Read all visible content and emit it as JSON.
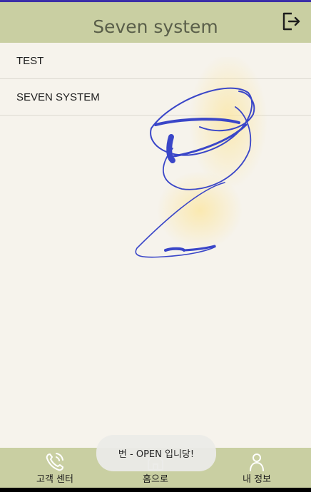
{
  "header": {
    "title": "Seven system",
    "logout_icon": "logout-icon"
  },
  "list": {
    "items": [
      {
        "label": "TEST"
      },
      {
        "label": "SEVEN SYSTEM"
      }
    ]
  },
  "bottom_nav": {
    "items": [
      {
        "label": "고객 센터",
        "icon": "phone-icon"
      },
      {
        "label": "홈으로",
        "icon": "home-icon"
      },
      {
        "label": "내 정보",
        "icon": "person-icon"
      }
    ]
  },
  "toast": {
    "message": "번 - OPEN 입니당!"
  },
  "colors": {
    "header_bg": "#c9cfa2",
    "page_bg": "#f6f3ec",
    "top_strip": "#3b2fa8",
    "scribble_stroke": "#3a46c8",
    "scribble_glow": "#fbe7a6"
  }
}
